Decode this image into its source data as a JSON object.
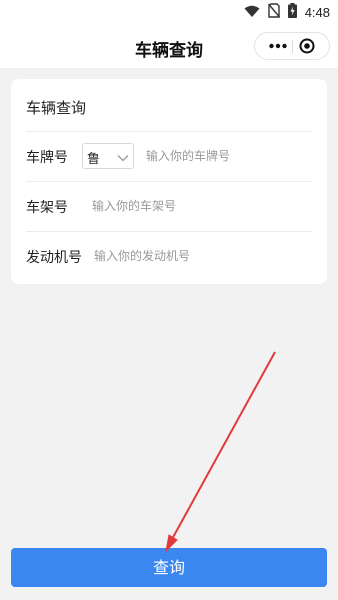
{
  "status_bar": {
    "time": "4:48",
    "icons": [
      "wifi-icon",
      "no-sim-icon",
      "battery-charging-icon"
    ]
  },
  "header": {
    "title": "车辆查询",
    "menu_icon": "more-dots-icon",
    "close_icon": "target-circle-icon"
  },
  "form": {
    "title": "车辆查询",
    "plate": {
      "label": "车牌号",
      "province": "鲁",
      "placeholder": "输入你的车牌号",
      "value": ""
    },
    "frame": {
      "label": "车架号",
      "placeholder": "输入你的车架号",
      "value": ""
    },
    "engine": {
      "label": "发动机号",
      "placeholder": "输入你的发动机号",
      "value": ""
    }
  },
  "query_button": {
    "label": "查询"
  },
  "colors": {
    "primary": "#3a87ef",
    "background": "#f2f2f2",
    "annotation": "#e03a3a"
  }
}
